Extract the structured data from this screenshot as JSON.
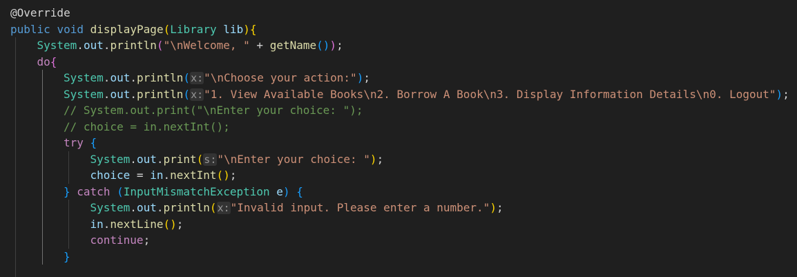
{
  "editor": {
    "lines": [
      {
        "indent": 0,
        "tokens": [
          {
            "t": "@Override",
            "c": "punc"
          }
        ]
      },
      {
        "indent": 0,
        "tokens": [
          {
            "t": "public",
            "c": "kw"
          },
          {
            "t": " ",
            "c": "punc"
          },
          {
            "t": "void",
            "c": "kw"
          },
          {
            "t": " ",
            "c": "punc"
          },
          {
            "t": "displayPage",
            "c": "fn"
          },
          {
            "t": "(",
            "c": "b1"
          },
          {
            "t": "Library",
            "c": "type"
          },
          {
            "t": " ",
            "c": "punc"
          },
          {
            "t": "lib",
            "c": "var"
          },
          {
            "t": ")",
            "c": "b1"
          },
          {
            "t": "{",
            "c": "b1"
          }
        ]
      },
      {
        "indent": 1,
        "tokens": [
          {
            "t": "System",
            "c": "type"
          },
          {
            "t": ".",
            "c": "punc"
          },
          {
            "t": "out",
            "c": "var"
          },
          {
            "t": ".",
            "c": "punc"
          },
          {
            "t": "println",
            "c": "fn"
          },
          {
            "t": "(",
            "c": "b2"
          },
          {
            "t": "\"\\nWelcome, \"",
            "c": "str"
          },
          {
            "t": " + ",
            "c": "punc"
          },
          {
            "t": "getName",
            "c": "fn"
          },
          {
            "t": "(",
            "c": "b3"
          },
          {
            "t": ")",
            "c": "b3"
          },
          {
            "t": ")",
            "c": "b2"
          },
          {
            "t": ";",
            "c": "punc"
          }
        ]
      },
      {
        "indent": 1,
        "tokens": [
          {
            "t": "do",
            "c": "ctl"
          },
          {
            "t": "{",
            "c": "b2"
          }
        ]
      },
      {
        "indent": 2,
        "tokens": [
          {
            "t": "System",
            "c": "type"
          },
          {
            "t": ".",
            "c": "punc"
          },
          {
            "t": "out",
            "c": "var"
          },
          {
            "t": ".",
            "c": "punc"
          },
          {
            "t": "println",
            "c": "fn"
          },
          {
            "t": "(",
            "c": "b3"
          },
          {
            "t": "x:",
            "c": "hint"
          },
          {
            "t": "\"\\nChoose your action:\"",
            "c": "str"
          },
          {
            "t": ")",
            "c": "b3"
          },
          {
            "t": ";",
            "c": "punc"
          }
        ]
      },
      {
        "indent": 2,
        "tokens": [
          {
            "t": "System",
            "c": "type"
          },
          {
            "t": ".",
            "c": "punc"
          },
          {
            "t": "out",
            "c": "var"
          },
          {
            "t": ".",
            "c": "punc"
          },
          {
            "t": "println",
            "c": "fn"
          },
          {
            "t": "(",
            "c": "b3"
          },
          {
            "t": "x:",
            "c": "hint"
          },
          {
            "t": "\"1. View Available Books\\n2. Borrow A Book\\n3. Display Information Details\\n0. Logout\"",
            "c": "str"
          },
          {
            "t": ")",
            "c": "b3"
          },
          {
            "t": ";",
            "c": "punc"
          }
        ]
      },
      {
        "indent": 2,
        "tokens": [
          {
            "t": "// System.out.print(\"\\nEnter your choice: \");",
            "c": "cmt"
          }
        ]
      },
      {
        "indent": 2,
        "tokens": [
          {
            "t": "// choice = in.nextInt();",
            "c": "cmt"
          }
        ]
      },
      {
        "indent": 2,
        "tokens": [
          {
            "t": "try",
            "c": "ctl"
          },
          {
            "t": " ",
            "c": "punc"
          },
          {
            "t": "{",
            "c": "b3"
          }
        ]
      },
      {
        "indent": 3,
        "tokens": [
          {
            "t": "System",
            "c": "type"
          },
          {
            "t": ".",
            "c": "punc"
          },
          {
            "t": "out",
            "c": "var"
          },
          {
            "t": ".",
            "c": "punc"
          },
          {
            "t": "print",
            "c": "fn"
          },
          {
            "t": "(",
            "c": "b1"
          },
          {
            "t": "s:",
            "c": "hint"
          },
          {
            "t": "\"\\nEnter your choice: \"",
            "c": "str"
          },
          {
            "t": ")",
            "c": "b1"
          },
          {
            "t": ";",
            "c": "punc"
          }
        ]
      },
      {
        "indent": 3,
        "tokens": [
          {
            "t": "choice",
            "c": "var"
          },
          {
            "t": " = ",
            "c": "punc"
          },
          {
            "t": "in",
            "c": "var"
          },
          {
            "t": ".",
            "c": "punc"
          },
          {
            "t": "nextInt",
            "c": "fn"
          },
          {
            "t": "(",
            "c": "b1"
          },
          {
            "t": ")",
            "c": "b1"
          },
          {
            "t": ";",
            "c": "punc"
          }
        ]
      },
      {
        "indent": 2,
        "tokens": [
          {
            "t": "}",
            "c": "b3"
          },
          {
            "t": " ",
            "c": "punc"
          },
          {
            "t": "catch",
            "c": "ctl"
          },
          {
            "t": " ",
            "c": "punc"
          },
          {
            "t": "(",
            "c": "b3"
          },
          {
            "t": "InputMismatchException",
            "c": "type"
          },
          {
            "t": " ",
            "c": "punc"
          },
          {
            "t": "e",
            "c": "var"
          },
          {
            "t": ")",
            "c": "b3"
          },
          {
            "t": " ",
            "c": "punc"
          },
          {
            "t": "{",
            "c": "b3"
          }
        ]
      },
      {
        "indent": 3,
        "tokens": [
          {
            "t": "System",
            "c": "type"
          },
          {
            "t": ".",
            "c": "punc"
          },
          {
            "t": "out",
            "c": "var"
          },
          {
            "t": ".",
            "c": "punc"
          },
          {
            "t": "println",
            "c": "fn"
          },
          {
            "t": "(",
            "c": "b1"
          },
          {
            "t": "x:",
            "c": "hint"
          },
          {
            "t": "\"Invalid input. Please enter a number.\"",
            "c": "str"
          },
          {
            "t": ")",
            "c": "b1"
          },
          {
            "t": ";",
            "c": "punc"
          }
        ]
      },
      {
        "indent": 3,
        "tokens": [
          {
            "t": "in",
            "c": "var"
          },
          {
            "t": ".",
            "c": "punc"
          },
          {
            "t": "nextLine",
            "c": "fn"
          },
          {
            "t": "(",
            "c": "b1"
          },
          {
            "t": ")",
            "c": "b1"
          },
          {
            "t": ";",
            "c": "punc"
          }
        ]
      },
      {
        "indent": 3,
        "tokens": [
          {
            "t": "continue",
            "c": "ctl"
          },
          {
            "t": ";",
            "c": "punc"
          }
        ]
      },
      {
        "indent": 2,
        "tokens": [
          {
            "t": "}",
            "c": "b3"
          }
        ]
      },
      {
        "indent": 1,
        "tokens": []
      }
    ]
  }
}
